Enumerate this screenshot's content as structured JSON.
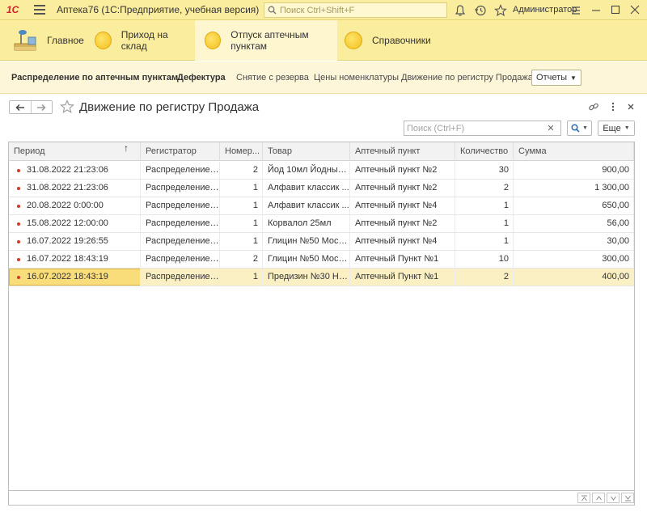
{
  "app": {
    "logo": "1С",
    "title": "Аптека76  (1С:Предприятие, учебная версия)",
    "search_placeholder": "Поиск Ctrl+Shift+F",
    "user": "Администратор"
  },
  "sections": [
    {
      "label": "Главное",
      "icon": "home-desk-icon"
    },
    {
      "label": "Приход на склад",
      "icon": "yellow-circle-icon"
    },
    {
      "label": "Отпуск аптечным пунктам",
      "icon": "yellow-circle-icon",
      "active": true
    },
    {
      "label": "Справочники",
      "icon": "yellow-circle-icon"
    }
  ],
  "commands": {
    "items": [
      "Распределение по аптечным пунктам",
      "Дефектура",
      "Снятие с резерва",
      "Цены номенклатуры",
      "Движение по регистру Продажа"
    ],
    "reports_label": "Отчеты"
  },
  "form": {
    "title": "Движение по регистру Продажа",
    "search_placeholder": "Поиск (Ctrl+F)",
    "more_label": "Еще"
  },
  "table": {
    "columns": [
      "Период",
      "Регистратор",
      "Номер...",
      "Товар",
      "Аптечный пункт",
      "Количество",
      "Сумма"
    ],
    "rows": [
      [
        "31.08.2022 21:23:06",
        "Распределение ...",
        "2",
        "Йод 10мл Йодные ...",
        "Аптечный пункт №2",
        "30",
        "900,00"
      ],
      [
        "31.08.2022 21:23:06",
        "Распределение ...",
        "1",
        "Алфавит классик ...",
        "Аптечный пункт №2",
        "2",
        "1 300,00"
      ],
      [
        "20.08.2022 0:00:00",
        "Распределение ...",
        "1",
        "Алфавит классик ...",
        "Аптечный пункт №4",
        "1",
        "650,00"
      ],
      [
        "15.08.2022 12:00:00",
        "Распределение ...",
        "1",
        "Корвалол 25мл",
        "Аптечный пункт №2",
        "1",
        "56,00"
      ],
      [
        "16.07.2022 19:26:55",
        "Распределение ...",
        "1",
        "Глицин №50 Мосф...",
        "Аптечный пункт №4",
        "1",
        "30,00"
      ],
      [
        "16.07.2022 18:43:19",
        "Распределение ...",
        "2",
        "Глицин №50 Мосф...",
        "Аптечный Пункт №1",
        "10",
        "300,00"
      ],
      [
        "16.07.2022 18:43:19",
        "Распределение ...",
        "1",
        "Предизин №30 Ни...",
        "Аптечный Пункт №1",
        "2",
        "400,00"
      ]
    ],
    "selected_row": 6,
    "sort_indicator": "↑"
  },
  "colors": {
    "panel": "#fbed9e",
    "command_panel": "#fdf6d8",
    "selected_row": "#fbf0c4",
    "selected_cell": "#f9dd7a",
    "row_marker": "#d9342b"
  }
}
